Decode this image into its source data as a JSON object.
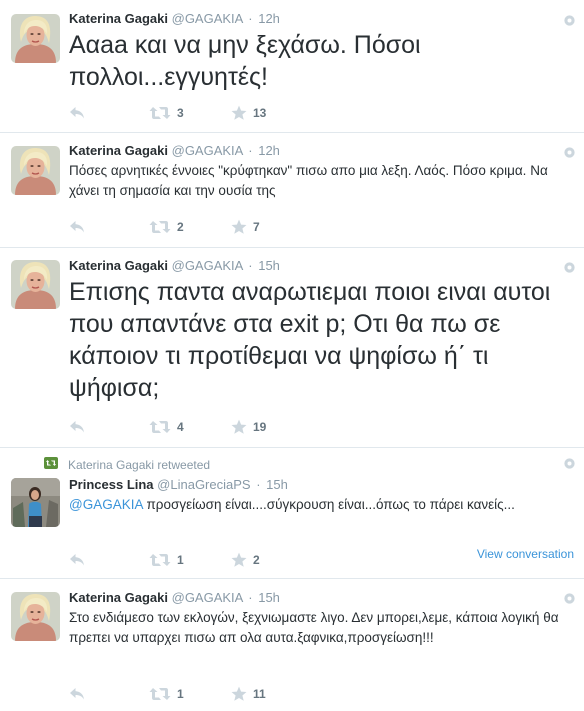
{
  "tweets": [
    {
      "name": "Katerina Gagaki",
      "handle": "@GAGAKIA",
      "dot": "·",
      "time": "12h",
      "text": "Ααaa και να μην ξεχάσω. Πόσοι πολλοι...εγγυητές!",
      "retweets": "3",
      "favorites": "13"
    },
    {
      "name": "Katerina Gagaki",
      "handle": "@GAGAKIA",
      "dot": "·",
      "time": "12h",
      "text": "Πόσες αρνητικές έννοιες \"κρύφτηκαν\" πισω απο μια λεξη. Λαός. Πόσο κριμα. Να χάνει τη σημασία και την ουσία της",
      "retweets": "2",
      "favorites": "7"
    },
    {
      "name": "Katerina Gagaki",
      "handle": "@GAGAKIA",
      "dot": "·",
      "time": "15h",
      "text": "Επισης παντα αναρωτιεμαι ποιοι ειναι αυτοι που απαντάνε στα exit p; Οτι θα πω σε κάποιον τι προτίθεμαι να ψηφίσω ή΄ τι ψήφισα;",
      "retweets": "4",
      "favorites": "19"
    },
    {
      "context": "Katerina Gagaki retweeted",
      "name": "Princess Lina",
      "handle": "@LinaGreciaPS",
      "dot": "·",
      "time": "15h",
      "mention": "@GAGAKIA",
      "text": " προσγείωση είναι....σύγκρουση είναι...όπως το πάρει κανείς...",
      "retweets": "1",
      "favorites": "2",
      "view_conversation": "View conversation"
    },
    {
      "name": "Katerina Gagaki",
      "handle": "@GAGAKIA",
      "dot": "·",
      "time": "15h",
      "text": "Στο ενδιάμεσο των εκλογών, ξεχνιωμαστε λιγο. Δεν μπορει,λεμε, κάποια λογική θα πρεπει να υπαρχει πισω απ ολα αυτα.ξαφνικα,προσγείωση!!!",
      "retweets": "1",
      "favorites": "11"
    }
  ],
  "icons": {
    "reply": "reply-icon",
    "retweet": "retweet-icon",
    "favorite": "star-icon",
    "more": "gear-icon",
    "retweeted_context": "retweet-context-icon"
  },
  "colors": {
    "link": "#3b94d9",
    "muted": "#8899a6",
    "text": "#292f33",
    "retweet_context_green": "#5c913b"
  }
}
